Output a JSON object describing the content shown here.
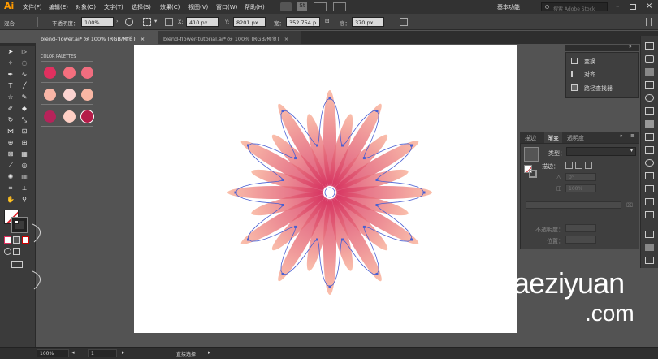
{
  "app": {
    "logo": "Ai"
  },
  "menu": [
    "文件(F)",
    "编辑(E)",
    "对象(O)",
    "文字(T)",
    "选择(S)",
    "效果(C)",
    "视图(V)",
    "窗口(W)",
    "帮助(H)"
  ],
  "workspace": {
    "label": "基本功能",
    "search_placeholder": "搜索 Adobe Stock"
  },
  "control": {
    "mode": "混合",
    "opacity_label": "不透明度：",
    "opacity_value": "100%",
    "x_label": "X:",
    "x_value": "410 px",
    "y_label": "Y:",
    "y_value": "8201 px",
    "w_label": "宽：",
    "w_value": "352.754 p",
    "h_label": "高：",
    "h_value": "370 px"
  },
  "tabs": [
    {
      "label": "blend-flower.ai* @ 100% (RGB/预览)",
      "close": "×"
    },
    {
      "label": "blend-flower-tutorial.ai* @ 100% (RGB/预览)",
      "close": "×"
    }
  ],
  "palette": {
    "title": "COLOR PALETTES",
    "colors": [
      "#e0305f",
      "#f56f7e",
      "#f06d7f",
      "#f8b5a6",
      "#fbd3d0",
      "#f9b7a4",
      "#b7235a",
      "#ffcfc4",
      "#b51c49"
    ]
  },
  "transform_panel": {
    "items": [
      "变换",
      "对齐",
      "路径查找器"
    ]
  },
  "gradient_panel": {
    "tabs": [
      "描边",
      "渐变",
      "透明度"
    ],
    "type_label": "类型：",
    "stroke_label": "描边：",
    "angle_value": "0°",
    "aspect_value": "100%",
    "opacity_label": "不透明度：",
    "position_label": "位置："
  },
  "status": {
    "zoom": "100%",
    "page": "1",
    "tool": "直接选择"
  },
  "watermark": {
    "text1": "aeziyuan",
    "text2": ".com"
  }
}
